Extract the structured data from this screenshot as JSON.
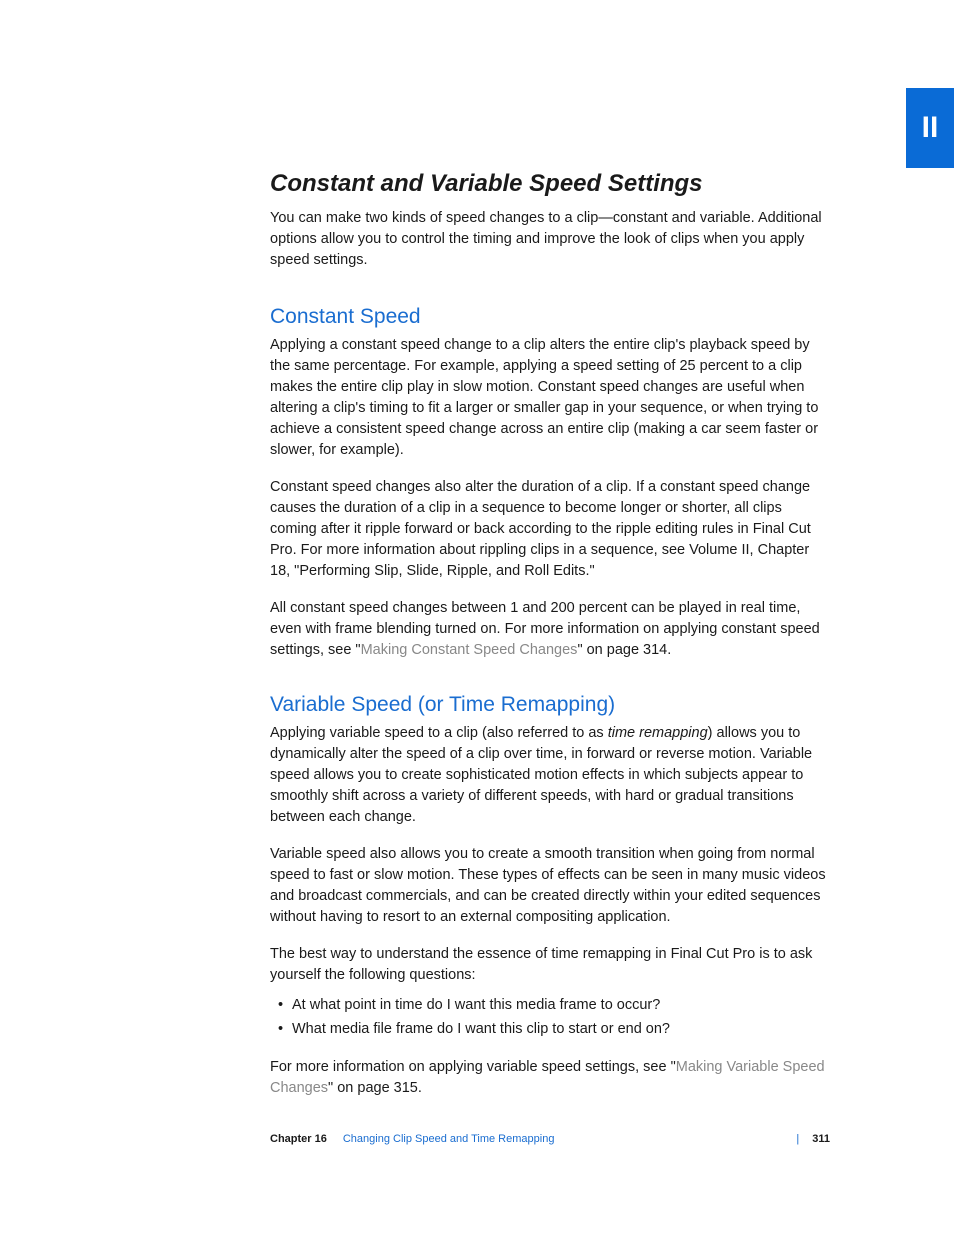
{
  "tab": "II",
  "title": "Constant and Variable Speed Settings",
  "intro": "You can make two kinds of speed changes to a clip—constant and variable. Additional options allow you to control the timing and improve the look of clips when you apply speed settings.",
  "section1": {
    "heading": "Constant Speed",
    "p1": "Applying a constant speed change to a clip alters the entire clip's playback speed by the same percentage. For example, applying a speed setting of 25 percent to a clip makes the entire clip play in slow motion. Constant speed changes are useful when altering a clip's timing to fit a larger or smaller gap in your sequence, or when trying to achieve a consistent speed change across an entire clip (making a car seem faster or slower, for example).",
    "p2": "Constant speed changes also alter the duration of a clip. If a constant speed change causes the duration of a clip in a sequence to become longer or shorter, all clips coming after it ripple forward or back according to the ripple editing rules in Final Cut Pro. For more information about rippling clips in a sequence, see Volume II, Chapter 18, \"Performing Slip, Slide, Ripple, and Roll Edits.\"",
    "p3_a": "All constant speed changes between 1 and 200 percent can be played in real time, even with frame blending turned on. For more information on applying constant speed settings, see \"",
    "p3_link": "Making Constant Speed Changes",
    "p3_b": "\" on page 314."
  },
  "section2": {
    "heading": "Variable Speed (or Time Remapping)",
    "p1_a": "Applying variable speed to a clip (also referred to as ",
    "p1_em": "time remapping",
    "p1_b": ") allows you to dynamically alter the speed of a clip over time, in forward or reverse motion. Variable speed allows you to create sophisticated motion effects in which subjects appear to smoothly shift across a variety of different speeds, with hard or gradual transitions between each change.",
    "p2": "Variable speed also allows you to create a smooth transition when going from normal speed to fast or slow motion. These types of effects can be seen in many music videos and broadcast commercials, and can be created directly within your edited sequences without having to resort to an external compositing application.",
    "p3": "The best way to understand the essence of time remapping in Final Cut Pro is to ask yourself the following questions:",
    "bullets": {
      "0": "At what point in time do I want this media frame to occur?",
      "1": "What media file frame do I want this clip to start or end on?"
    },
    "p4_a": "For more information on applying variable speed settings, see \"",
    "p4_link": "Making Variable Speed Changes",
    "p4_b": "\" on page 315."
  },
  "footer": {
    "chapter": "Chapter 16",
    "title": "Changing Clip Speed and Time Remapping",
    "page": "311"
  }
}
